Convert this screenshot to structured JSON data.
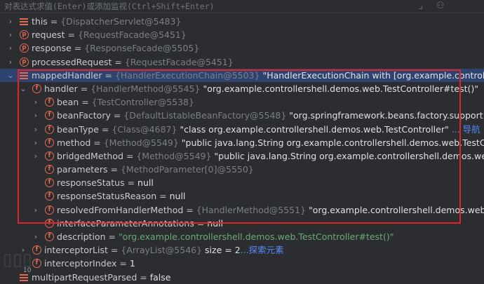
{
  "hint": {
    "text": "对表达式求值(Enter)或添加监视(Ctrl+Shift+Enter)",
    "right_icons": [
      "bracket-icon",
      "glasses-icon"
    ]
  },
  "rows": [
    {
      "name": "this",
      "sep": " = ",
      "ref": "{DispatcherServlet@5483}",
      "val": "",
      "link": "",
      "icon": "lines",
      "expand": "collapsed",
      "indent": 0
    },
    {
      "name": "request",
      "sep": " = ",
      "ref": "{RequestFacade@5451}",
      "val": "",
      "link": "",
      "icon": "p",
      "expand": "collapsed",
      "indent": 0
    },
    {
      "name": "response",
      "sep": " = ",
      "ref": "{ResponseFacade@5505}",
      "val": "",
      "link": "",
      "icon": "p",
      "expand": "collapsed",
      "indent": 0
    },
    {
      "name": "processedRequest",
      "sep": " = ",
      "ref": "{RequestFacade@5451}",
      "val": "",
      "link": "",
      "icon": "p",
      "expand": "collapsed",
      "indent": 0
    },
    {
      "name": "mappedHandler",
      "sep": " = ",
      "ref": "{HandlerExecutionChain@5503}",
      "val": " \"HandlerExecutionChain with [org.example.controllershell.demos",
      "link": "",
      "icon": "lines",
      "expand": "expanded",
      "indent": 0,
      "selected": true
    },
    {
      "name": "handler",
      "sep": " = ",
      "ref": "{HandlerMethod@5545}",
      "val": " \"org.example.controllershell.demos.web.TestController#test()\"",
      "link": "",
      "icon": "f",
      "expand": "expanded",
      "indent": 1
    },
    {
      "name": "bean",
      "sep": " = ",
      "ref": "{TestController@5538}",
      "val": "",
      "link": "",
      "icon": "f",
      "expand": "collapsed",
      "indent": 2
    },
    {
      "name": "beanFactory",
      "sep": " = ",
      "ref": "{DefaultListableBeanFactory@5548}",
      "val": " \"org.springframework.beans.factory.support.Defaul",
      "link": "... 显示",
      "icon": "f",
      "expand": "collapsed",
      "indent": 2
    },
    {
      "name": "beanType",
      "sep": " = ",
      "ref": "{Class@4687}",
      "val": " \"class org.example.controllershell.demos.web.TestController\"",
      "link": " ... 导航",
      "icon": "f",
      "expand": "collapsed",
      "indent": 2
    },
    {
      "name": "method",
      "sep": " = ",
      "ref": "{Method@5549}",
      "val": " \"public java.lang.String org.example.controllershell.demos.web.TestController.test",
      "link": "",
      "icon": "f",
      "expand": "collapsed",
      "indent": 2
    },
    {
      "name": "bridgedMethod",
      "sep": " = ",
      "ref": "{Method@5549}",
      "val": " \"public java.lang.String org.example.controllershell.demos.web.TestContr",
      "link": "",
      "icon": "f",
      "expand": "collapsed",
      "indent": 2
    },
    {
      "name": "parameters",
      "sep": " = ",
      "ref": "{MethodParameter[0]@5550}",
      "val": "",
      "link": "",
      "icon": "f",
      "expand": "none",
      "indent": 2
    },
    {
      "name": "responseStatus",
      "sep": " = ",
      "ref": "",
      "val": "null",
      "link": "",
      "icon": "f",
      "expand": "none",
      "indent": 2
    },
    {
      "name": "responseStatusReason",
      "sep": " = ",
      "ref": "",
      "val": "null",
      "link": "",
      "icon": "f",
      "expand": "none",
      "indent": 2
    },
    {
      "name": "resolvedFromHandlerMethod",
      "sep": " = ",
      "ref": "{HandlerMethod@5551}",
      "val": " \"org.example.controllershell.demos.web.TestContro",
      "link": "",
      "icon": "f",
      "expand": "collapsed",
      "indent": 2
    },
    {
      "name": "interfaceParameterAnnotations",
      "sep": " = ",
      "ref": "",
      "val": "null",
      "link": "",
      "icon": "f",
      "expand": "none",
      "indent": 2
    },
    {
      "name": "description",
      "sep": " = ",
      "ref": "",
      "val": "\"org.example.controllershell.demos.web.TestController#test()\"",
      "link": "",
      "icon": "f",
      "expand": "collapsed",
      "indent": 2,
      "val_style": "str"
    },
    {
      "name": "interceptorList",
      "sep": " = ",
      "ref": "{ArrayList@5546}",
      "val": "  size = 2",
      "link": "...探索元素",
      "icon": "f",
      "expand": "collapsed",
      "indent": 1
    },
    {
      "name": "interceptorIndex",
      "sep": " = ",
      "ref": "",
      "val": "1",
      "link": "",
      "icon": "f",
      "expand": "none",
      "indent": 1
    },
    {
      "name": "multipartRequestParsed",
      "sep": " = ",
      "ref": "",
      "val": "false",
      "link": "",
      "icon": "lines",
      "expand": "none",
      "indent": 0
    }
  ],
  "gutter_number": "10",
  "watermark_text": "FREEBUF"
}
